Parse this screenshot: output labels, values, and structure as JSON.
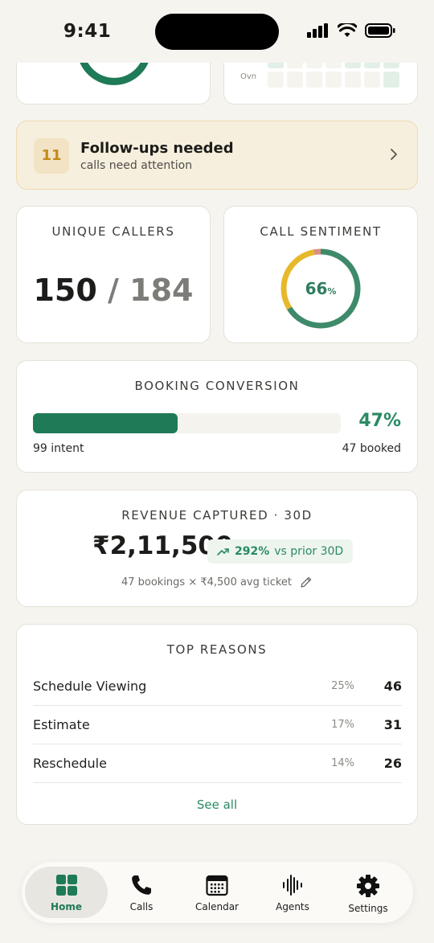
{
  "status": {
    "time": "9:41"
  },
  "heatmap": {
    "row_label": "Ovn"
  },
  "followups": {
    "count": "11",
    "title": "Follow-ups needed",
    "subtitle": "calls need attention"
  },
  "callers": {
    "label": "UNIQUE CALLERS",
    "unique": "150",
    "separator": "/",
    "total": "184"
  },
  "sentiment": {
    "label": "CALL SENTIMENT",
    "value": "66",
    "unit": "%",
    "positive_fraction": 0.66,
    "neutral_fraction": 0.31,
    "negative_fraction": 0.03
  },
  "booking": {
    "label": "BOOKING CONVERSION",
    "percent_text": "47%",
    "fraction": 0.47,
    "intent": "99 intent",
    "booked": "47 booked"
  },
  "revenue": {
    "label": "REVENUE CAPTURED · 30D",
    "amount": "₹2,11,500",
    "change_value": "292%",
    "change_text": "vs prior 30D",
    "note": "47 bookings × ₹4,500 avg ticket"
  },
  "reasons": {
    "label": "TOP REASONS",
    "items": [
      {
        "name": "Schedule Viewing",
        "pct": "25%",
        "count": "46"
      },
      {
        "name": "Estimate",
        "pct": "17%",
        "count": "31"
      },
      {
        "name": "Reschedule",
        "pct": "14%",
        "count": "26"
      }
    ],
    "see_all": "See all"
  },
  "tabs": [
    {
      "label": "Home",
      "icon": "grid-icon"
    },
    {
      "label": "Calls",
      "icon": "phone-icon"
    },
    {
      "label": "Calendar",
      "icon": "calendar-icon"
    },
    {
      "label": "Agents",
      "icon": "waveform-icon"
    },
    {
      "label": "Settings",
      "icon": "gear-icon"
    }
  ],
  "colors": {
    "accent": "#1e7a57",
    "warning": "#e6b92d",
    "negative": "#d98f7f"
  }
}
